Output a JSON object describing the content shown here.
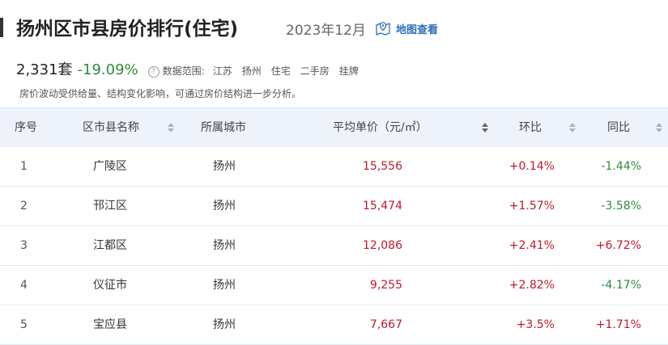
{
  "header": {
    "title": "扬州区市县房价排行(住宅)",
    "date": "2023年12月",
    "map_link": "地图查看"
  },
  "stats": {
    "count": "2,331套",
    "change": "-19.09%",
    "help_icon": "?",
    "scope_label": "数据范围:",
    "scope": [
      "江苏",
      "扬州",
      "住宅",
      "二手房",
      "挂牌"
    ]
  },
  "note": "房价波动受供给量、结构变化影响，可通过房价结构进一步分析。",
  "table": {
    "columns": [
      "序号",
      "区市县名称",
      "所属城市",
      "平均单价（元/㎡）",
      "环比",
      "同比"
    ],
    "rows": [
      {
        "idx": "1",
        "name": "广陵区",
        "city": "扬州",
        "price": "15,556",
        "mom": "+0.14%",
        "yoy": "-1.44%"
      },
      {
        "idx": "2",
        "name": "邗江区",
        "city": "扬州",
        "price": "15,474",
        "mom": "+1.57%",
        "yoy": "-3.58%"
      },
      {
        "idx": "3",
        "name": "江都区",
        "city": "扬州",
        "price": "12,086",
        "mom": "+2.41%",
        "yoy": "+6.72%"
      },
      {
        "idx": "4",
        "name": "仪征市",
        "city": "扬州",
        "price": "9,255",
        "mom": "+2.82%",
        "yoy": "-4.17%"
      },
      {
        "idx": "5",
        "name": "宝应县",
        "city": "扬州",
        "price": "7,667",
        "mom": "+3.5%",
        "yoy": "+1.71%"
      }
    ]
  },
  "colors": {
    "up": "#c0182d",
    "down": "#2e8b3b",
    "link": "#2f6fb7",
    "header_bg": "#eef3fb"
  }
}
